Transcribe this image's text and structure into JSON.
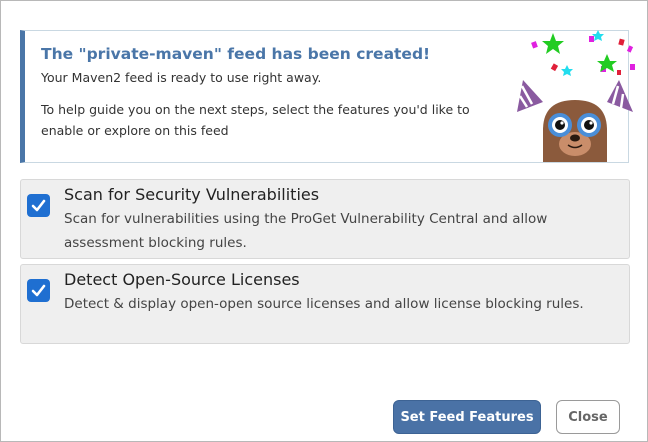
{
  "banner": {
    "title": "The \"private-maven\" feed has been created!",
    "subtitle": "Your Maven2 feed is ready to use right away.",
    "guide": "To help guide you on the next steps, select the features you'd like to enable or explore on this feed",
    "illustration": "otter-party-mascot"
  },
  "features": [
    {
      "checked": true,
      "title": "Scan for Security Vulnerabilities",
      "description": "Scan for vulnerabilities using the ProGet Vulnerability Central and allow assessment blocking rules."
    },
    {
      "checked": true,
      "title": "Detect Open-Source Licenses",
      "description": "Detect & display open-open source licenses and allow license blocking rules."
    }
  ],
  "buttons": {
    "primary_label": "Set Feed Features",
    "close_label": "Close"
  },
  "colors": {
    "accent": "#4a76a8",
    "checkbox": "#1f6fd1",
    "primary_button": "#4a72a6"
  }
}
